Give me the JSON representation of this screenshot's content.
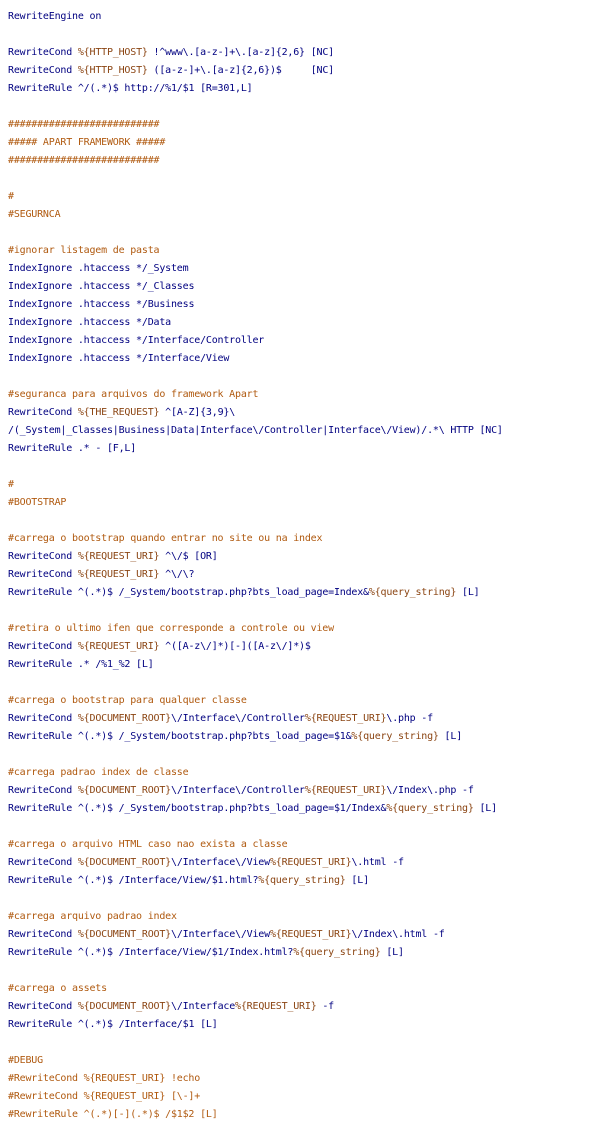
{
  "lines": [
    [
      [
        "dir",
        "RewriteEngine"
      ],
      [
        "plain",
        " on"
      ]
    ],
    [],
    [
      [
        "dir",
        "RewriteCond"
      ],
      [
        "plain",
        " "
      ],
      [
        "var",
        "%{HTTP_HOST}"
      ],
      [
        "plain",
        " !^www\\.[a-z-]+\\.[a-z]{2,6} [NC]"
      ]
    ],
    [
      [
        "dir",
        "RewriteCond"
      ],
      [
        "plain",
        " "
      ],
      [
        "var",
        "%{HTTP_HOST}"
      ],
      [
        "plain",
        " ([a-z-]+\\.[a-z]{2,6})$     [NC]"
      ]
    ],
    [
      [
        "dir",
        "RewriteRule"
      ],
      [
        "plain",
        " ^/(.*)$ http://%1/$1 [R=301,L]"
      ]
    ],
    [],
    [
      [
        "comment",
        "##########################"
      ]
    ],
    [
      [
        "comment",
        "##### APART FRAMEWORK #####"
      ]
    ],
    [
      [
        "comment",
        "##########################"
      ]
    ],
    [],
    [
      [
        "comment",
        "#"
      ]
    ],
    [
      [
        "comment",
        "#SEGURNCA"
      ]
    ],
    [],
    [
      [
        "comment",
        "#ignorar listagem de pasta"
      ]
    ],
    [
      [
        "dir",
        "IndexIgnore"
      ],
      [
        "plain",
        " .htaccess */_System"
      ]
    ],
    [
      [
        "dir",
        "IndexIgnore"
      ],
      [
        "plain",
        " .htaccess */_Classes"
      ]
    ],
    [
      [
        "dir",
        "IndexIgnore"
      ],
      [
        "plain",
        " .htaccess */Business"
      ]
    ],
    [
      [
        "dir",
        "IndexIgnore"
      ],
      [
        "plain",
        " .htaccess */Data"
      ]
    ],
    [
      [
        "dir",
        "IndexIgnore"
      ],
      [
        "plain",
        " .htaccess */Interface/Controller"
      ]
    ],
    [
      [
        "dir",
        "IndexIgnore"
      ],
      [
        "plain",
        " .htaccess */Interface/View"
      ]
    ],
    [],
    [
      [
        "comment",
        "#seguranca para arquivos do framework Apart"
      ]
    ],
    [
      [
        "dir",
        "RewriteCond"
      ],
      [
        "plain",
        " "
      ],
      [
        "var",
        "%{THE_REQUEST}"
      ],
      [
        "plain",
        " ^[A-Z]{3,9}\\"
      ]
    ],
    [
      [
        "plain",
        "/(_System|_Classes|Business|Data|Interface\\/Controller|Interface\\/View)/.*\\ HTTP [NC]"
      ]
    ],
    [
      [
        "dir",
        "RewriteRule"
      ],
      [
        "plain",
        " .* - [F,L]"
      ]
    ],
    [],
    [
      [
        "comment",
        "#"
      ]
    ],
    [
      [
        "comment",
        "#BOOTSTRAP"
      ]
    ],
    [],
    [
      [
        "comment",
        "#carrega o bootstrap quando entrar no site ou na index"
      ]
    ],
    [
      [
        "dir",
        "RewriteCond"
      ],
      [
        "plain",
        " "
      ],
      [
        "var",
        "%{REQUEST_URI}"
      ],
      [
        "plain",
        " ^\\/$ [OR]"
      ]
    ],
    [
      [
        "dir",
        "RewriteCond"
      ],
      [
        "plain",
        " "
      ],
      [
        "var",
        "%{REQUEST_URI}"
      ],
      [
        "plain",
        " ^\\/\\?"
      ]
    ],
    [
      [
        "dir",
        "RewriteRule"
      ],
      [
        "plain",
        " ^(.*)$ /_System/bootstrap.php?bts_load_page=Index&"
      ],
      [
        "var",
        "%{query_string}"
      ],
      [
        "plain",
        " [L]"
      ]
    ],
    [],
    [
      [
        "comment",
        "#retira o ultimo ifen que corresponde a controle ou view"
      ]
    ],
    [
      [
        "dir",
        "RewriteCond"
      ],
      [
        "plain",
        " "
      ],
      [
        "var",
        "%{REQUEST_URI}"
      ],
      [
        "plain",
        " ^([A-z\\/]*)[-]([A-z\\/]*)$"
      ]
    ],
    [
      [
        "dir",
        "RewriteRule"
      ],
      [
        "plain",
        " .* /%1_%2 [L]"
      ]
    ],
    [],
    [
      [
        "comment",
        "#carrega o bootstrap para qualquer classe"
      ]
    ],
    [
      [
        "dir",
        "RewriteCond"
      ],
      [
        "plain",
        " "
      ],
      [
        "var",
        "%{DOCUMENT_ROOT}"
      ],
      [
        "plain",
        "\\/Interface\\/Controller"
      ],
      [
        "var",
        "%{REQUEST_URI}"
      ],
      [
        "plain",
        "\\.php -f"
      ]
    ],
    [
      [
        "dir",
        "RewriteRule"
      ],
      [
        "plain",
        " ^(.*)$ /_System/bootstrap.php?bts_load_page=$1&"
      ],
      [
        "var",
        "%{query_string}"
      ],
      [
        "plain",
        " [L]"
      ]
    ],
    [],
    [
      [
        "comment",
        "#carrega padrao index de classe"
      ]
    ],
    [
      [
        "dir",
        "RewriteCond"
      ],
      [
        "plain",
        " "
      ],
      [
        "var",
        "%{DOCUMENT_ROOT}"
      ],
      [
        "plain",
        "\\/Interface\\/Controller"
      ],
      [
        "var",
        "%{REQUEST_URI}"
      ],
      [
        "plain",
        "\\/Index\\.php -f"
      ]
    ],
    [
      [
        "dir",
        "RewriteRule"
      ],
      [
        "plain",
        " ^(.*)$ /_System/bootstrap.php?bts_load_page=$1/Index&"
      ],
      [
        "var",
        "%{query_string}"
      ],
      [
        "plain",
        " [L]"
      ]
    ],
    [],
    [
      [
        "comment",
        "#carrega o arquivo HTML caso nao exista a classe"
      ]
    ],
    [
      [
        "dir",
        "RewriteCond"
      ],
      [
        "plain",
        " "
      ],
      [
        "var",
        "%{DOCUMENT_ROOT}"
      ],
      [
        "plain",
        "\\/Interface\\/View"
      ],
      [
        "var",
        "%{REQUEST_URI}"
      ],
      [
        "plain",
        "\\.html -f"
      ]
    ],
    [
      [
        "dir",
        "RewriteRule"
      ],
      [
        "plain",
        " ^(.*)$ /Interface/View/$1.html?"
      ],
      [
        "var",
        "%{query_string}"
      ],
      [
        "plain",
        " [L]"
      ]
    ],
    [],
    [
      [
        "comment",
        "#carrega arquivo padrao index"
      ]
    ],
    [
      [
        "dir",
        "RewriteCond"
      ],
      [
        "plain",
        " "
      ],
      [
        "var",
        "%{DOCUMENT_ROOT}"
      ],
      [
        "plain",
        "\\/Interface\\/View"
      ],
      [
        "var",
        "%{REQUEST_URI}"
      ],
      [
        "plain",
        "\\/Index\\.html -f"
      ]
    ],
    [
      [
        "dir",
        "RewriteRule"
      ],
      [
        "plain",
        " ^(.*)$ /Interface/View/$1/Index.html?"
      ],
      [
        "var",
        "%{query_string}"
      ],
      [
        "plain",
        " [L]"
      ]
    ],
    [],
    [
      [
        "comment",
        "#carrega o assets"
      ]
    ],
    [
      [
        "dir",
        "RewriteCond"
      ],
      [
        "plain",
        " "
      ],
      [
        "var",
        "%{DOCUMENT_ROOT}"
      ],
      [
        "plain",
        "\\/Interface"
      ],
      [
        "var",
        "%{REQUEST_URI}"
      ],
      [
        "plain",
        " -f"
      ]
    ],
    [
      [
        "dir",
        "RewriteRule"
      ],
      [
        "plain",
        " ^(.*)$ /Interface/$1 [L]"
      ]
    ],
    [],
    [
      [
        "comment",
        "#DEBUG"
      ]
    ],
    [
      [
        "comment",
        "#RewriteCond %{REQUEST_URI} !echo"
      ]
    ],
    [
      [
        "comment",
        "#RewriteCond %{REQUEST_URI} [\\-]+"
      ]
    ],
    [
      [
        "comment",
        "#RewriteRule ^(.*)[-](.*)$ /$1$2 [L]"
      ]
    ]
  ]
}
